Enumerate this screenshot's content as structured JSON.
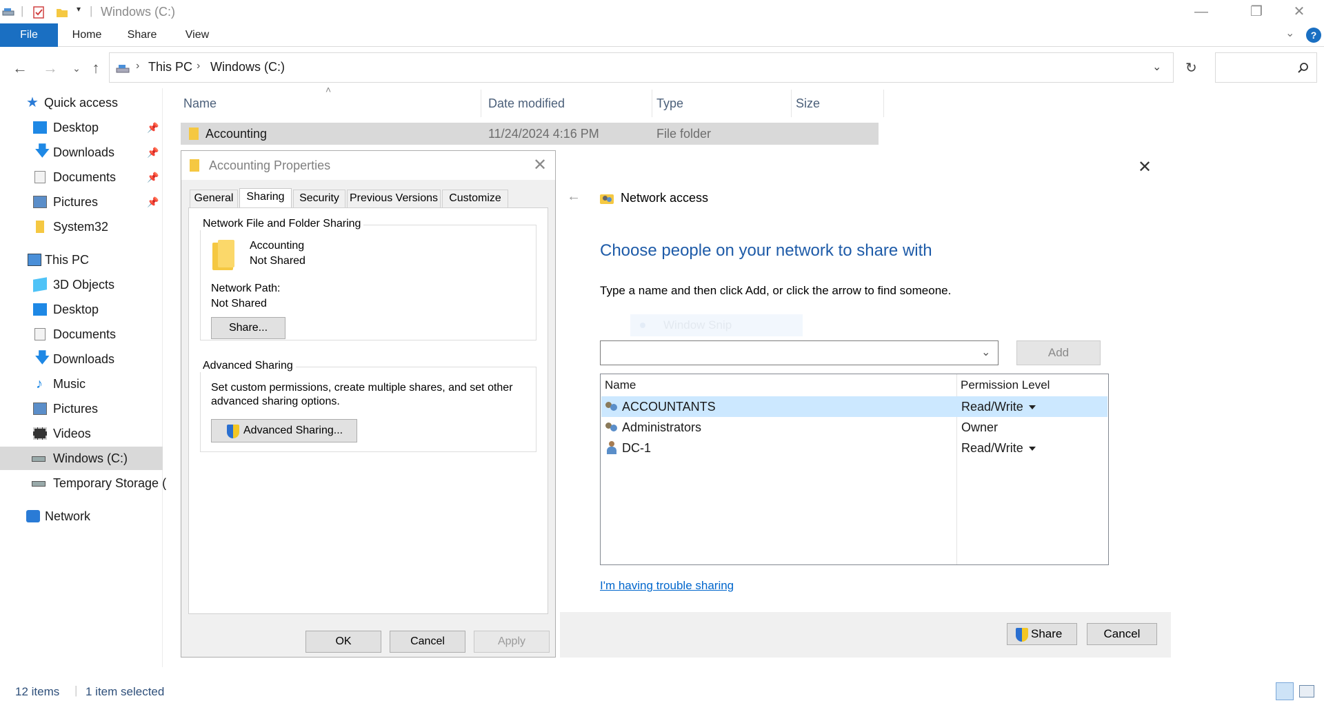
{
  "window": {
    "title": "Windows (C:)"
  },
  "ribbon": {
    "tabs": [
      "File",
      "Home",
      "Share",
      "View"
    ]
  },
  "address": {
    "path": [
      "This PC",
      "Windows (C:)"
    ],
    "search_placeholder": ""
  },
  "sidebar": {
    "items": [
      {
        "label": "Quick access",
        "pinned": false
      },
      {
        "label": "Desktop",
        "pinned": true
      },
      {
        "label": "Downloads",
        "pinned": true
      },
      {
        "label": "Documents",
        "pinned": true
      },
      {
        "label": "Pictures",
        "pinned": true
      },
      {
        "label": "System32",
        "pinned": false
      },
      {
        "label": "This PC",
        "pinned": false
      },
      {
        "label": "3D Objects",
        "pinned": false
      },
      {
        "label": "Desktop",
        "pinned": false
      },
      {
        "label": "Documents",
        "pinned": false
      },
      {
        "label": "Downloads",
        "pinned": false
      },
      {
        "label": "Music",
        "pinned": false
      },
      {
        "label": "Pictures",
        "pinned": false
      },
      {
        "label": "Videos",
        "pinned": false
      },
      {
        "label": "Windows (C:)",
        "pinned": false,
        "selected": true
      },
      {
        "label": "Temporary Storage (",
        "pinned": false
      },
      {
        "label": "Network",
        "pinned": false
      }
    ]
  },
  "filelist": {
    "columns": [
      "Name",
      "Date modified",
      "Type",
      "Size"
    ],
    "rows": [
      {
        "name": "Accounting",
        "date": "11/24/2024 4:16 PM",
        "type": "File folder",
        "size": ""
      }
    ]
  },
  "props": {
    "title": "Accounting Properties",
    "tabs": [
      "General",
      "Sharing",
      "Security",
      "Previous Versions",
      "Customize"
    ],
    "active_tab": "Sharing",
    "nffs_label": "Network File and Folder Sharing",
    "folder_name": "Accounting",
    "folder_status": "Not Shared",
    "network_path_label": "Network Path:",
    "network_path_value": "Not Shared",
    "share_button": "Share...",
    "adv_label": "Advanced Sharing",
    "adv_desc_line1": "Set custom permissions, create multiple shares, and set other",
    "adv_desc_line2": "advanced sharing options.",
    "adv_button": "Advanced Sharing...",
    "ok": "OK",
    "cancel": "Cancel",
    "apply": "Apply"
  },
  "netaccess": {
    "title": "Network access",
    "heading": "Choose people on your network to share with",
    "instruction": "Type a name and then click Add, or click the arrow to find someone.",
    "ghost_text": "Window Snip",
    "name_input_value": "",
    "add_button": "Add",
    "list_headers": [
      "Name",
      "Permission Level"
    ],
    "list": [
      {
        "name": "ACCOUNTANTS",
        "permission": "Read/Write",
        "has_dropdown": true,
        "selected": true,
        "icon": "group-icon"
      },
      {
        "name": "Administrators",
        "permission": "Owner",
        "has_dropdown": false,
        "selected": false,
        "icon": "group-icon"
      },
      {
        "name": "DC-1",
        "permission": "Read/Write",
        "has_dropdown": true,
        "selected": false,
        "icon": "user-icon"
      }
    ],
    "trouble_link": "I'm having trouble sharing",
    "share_button": "Share",
    "cancel_button": "Cancel"
  },
  "status": {
    "items_count": "12 items",
    "selected": "1 item selected"
  },
  "colors": {
    "accent": "#1a6fc2",
    "heading_blue": "#1e5ba8",
    "link": "#0066cc",
    "selection": "#cce8ff"
  }
}
